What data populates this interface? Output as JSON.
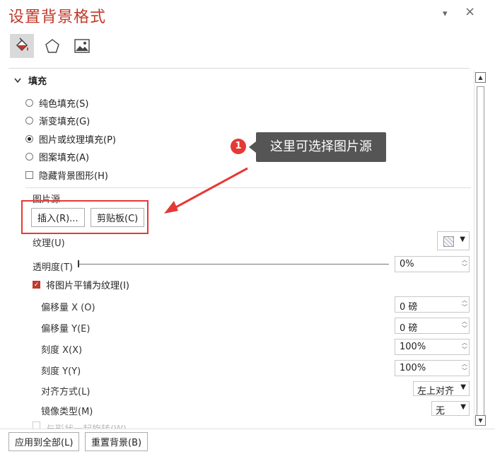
{
  "panel": {
    "title": "设置背景格式",
    "close": "×",
    "pin": "▾"
  },
  "tabs": [
    {
      "name": "fill-line-tab",
      "icon": "paint-bucket-icon"
    },
    {
      "name": "effects-tab",
      "icon": "pentagon-icon"
    },
    {
      "name": "picture-tab",
      "icon": "picture-icon"
    }
  ],
  "section": {
    "title": "填充",
    "chevron": "chevron-down-icon"
  },
  "fill_options": [
    {
      "label": "纯色填充(S)",
      "selected": false
    },
    {
      "label": "渐变填充(G)",
      "selected": false
    },
    {
      "label": "图片或纹理填充(P)",
      "selected": true
    },
    {
      "label": "图案填充(A)",
      "selected": false
    }
  ],
  "hide_graphics": {
    "label": "隐藏背景图形(H)",
    "checked": false
  },
  "picture_source": {
    "label": "图片源",
    "insert_button": "插入(R)...",
    "clipboard_button": "剪贴板(C)"
  },
  "texture": {
    "label": "纹理(U)"
  },
  "transparency": {
    "label": "透明度(T)",
    "value": "0%"
  },
  "tile": {
    "label": "将图片平铺为纹理(I)",
    "checked": true
  },
  "offset_x": {
    "label": "偏移量 X (O)",
    "value": "0 磅"
  },
  "offset_y": {
    "label": "偏移量 Y(E)",
    "value": "0 磅"
  },
  "scale_x": {
    "label": "刻度 X(X)",
    "value": "100%"
  },
  "scale_y": {
    "label": "刻度 Y(Y)",
    "value": "100%"
  },
  "alignment": {
    "label": "对齐方式(L)",
    "value": "左上对齐"
  },
  "mirror": {
    "label": "镜像类型(M)",
    "value": "无"
  },
  "rotate_with_shape": {
    "label": "与形状一起旋转(W)"
  },
  "footer": {
    "apply_all": "应用到全部(L)",
    "reset": "重置背景(B)"
  },
  "callout": {
    "number": "1",
    "text": "这里可选择图片源"
  },
  "colors": {
    "title": "#c0392b",
    "highlight": "#e53935",
    "tooltip_bg": "#555555"
  }
}
